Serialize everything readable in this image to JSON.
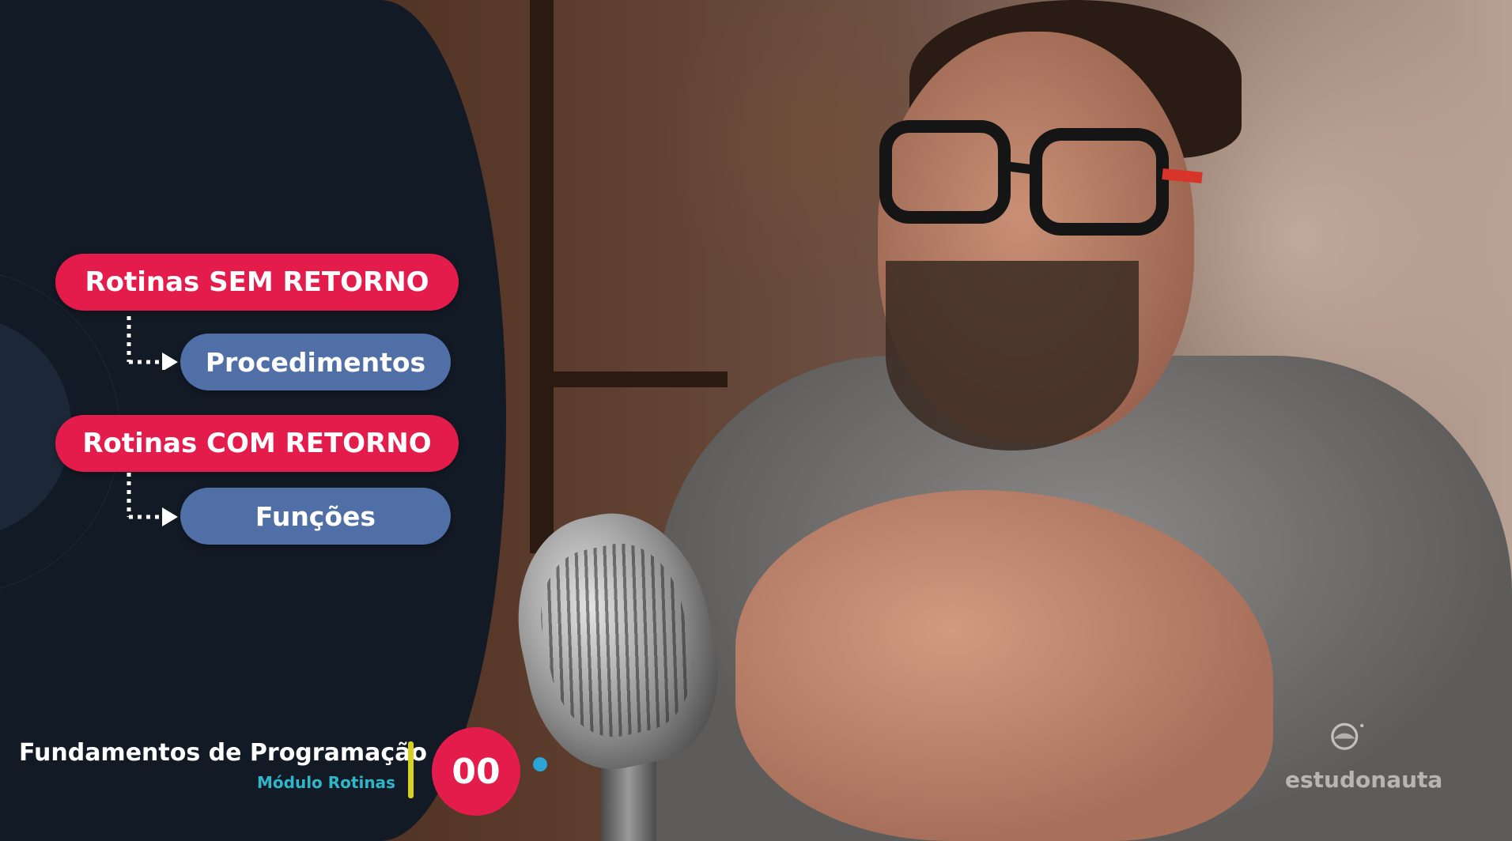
{
  "diagram": {
    "routine_without_return": "Rotinas SEM RETORNO",
    "procedures": "Procedimentos",
    "routine_with_return": "Rotinas COM RETORNO",
    "functions": "Funções"
  },
  "footer": {
    "course_title": "Fundamentos de Programação",
    "module": "Módulo Rotinas",
    "episode": "00"
  },
  "branding": {
    "logo_text": "estudonauta",
    "logo_icon": "astronaut-helmet-icon"
  },
  "colors": {
    "panel_bg": "#121a25",
    "red_pill": "#e41c4b",
    "blue_pill": "#4f6fa6",
    "accent_cyan": "#2fb7c9",
    "divider_yellow": "#d4d21e"
  }
}
